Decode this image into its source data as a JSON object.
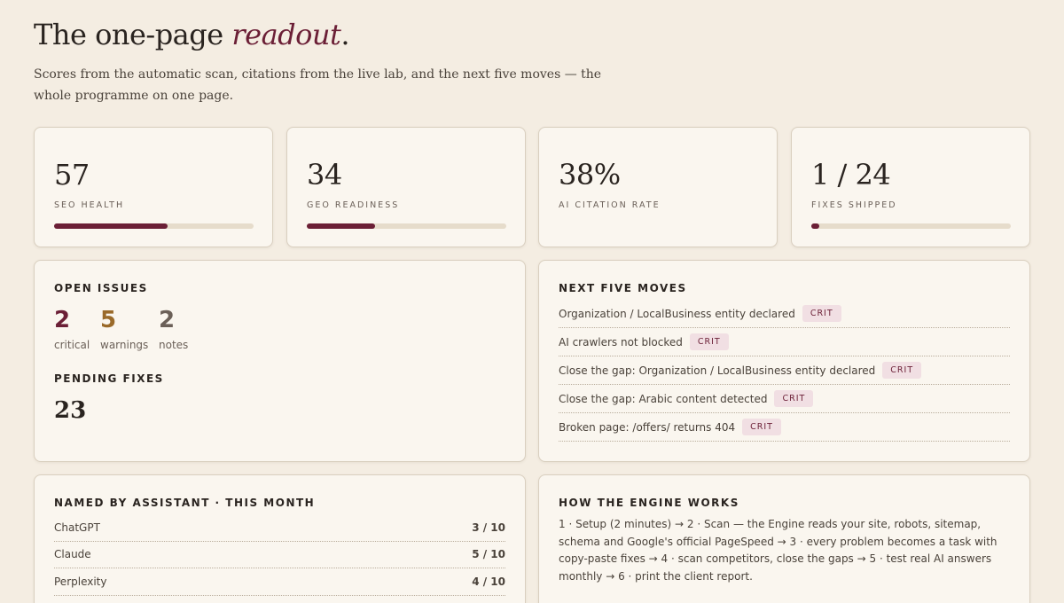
{
  "header": {
    "title_main": "The one-page ",
    "title_accent": "readout",
    "title_end": ".",
    "subtitle": "Scores from the automatic scan, citations from the live lab, and the next five moves — the whole programme on one page."
  },
  "stats": [
    {
      "value": "57",
      "label": "SEO HEALTH",
      "progress": 0.57
    },
    {
      "value": "34",
      "label": "GEO READINESS",
      "progress": 0.34
    },
    {
      "value": "38%",
      "label": "AI CITATION RATE"
    },
    {
      "value": "1 / 24",
      "label": "FIXES SHIPPED",
      "progress": 0.042
    }
  ],
  "issues": {
    "heading": "OPEN ISSUES",
    "groups": [
      {
        "count": "2",
        "label": "critical",
        "color": "#6b1f36"
      },
      {
        "count": "5",
        "label": "warnings",
        "color": "#9a6a2a"
      },
      {
        "count": "2",
        "label": "notes",
        "color": "#6b6058"
      }
    ],
    "pending_heading": "PENDING FIXES",
    "pending_count": "23"
  },
  "moves": {
    "heading": "NEXT FIVE MOVES",
    "items": [
      {
        "text": "Organization / LocalBusiness entity declared",
        "badge": "CRIT"
      },
      {
        "text": "AI crawlers not blocked",
        "badge": "CRIT"
      },
      {
        "text": "Close the gap: Organization / LocalBusiness entity declared",
        "badge": "CRIT"
      },
      {
        "text": "Close the gap: Arabic content detected",
        "badge": "CRIT"
      },
      {
        "text": "Broken page: /offers/ returns 404",
        "badge": "CRIT"
      }
    ]
  },
  "assistants": {
    "heading": "NAMED BY ASSISTANT · THIS MONTH",
    "rows": [
      {
        "name": "ChatGPT",
        "score": "3 / 10"
      },
      {
        "name": "Claude",
        "score": "5 / 10"
      },
      {
        "name": "Perplexity",
        "score": "4 / 10"
      }
    ]
  },
  "engine": {
    "heading": "HOW THE ENGINE WORKS",
    "body": "1 · Setup (2 minutes) → 2 · Scan — the Engine reads your site, robots, sitemap, schema and Google's official PageSpeed → 3 · every problem becomes a task with copy-paste fixes → 4 · scan competitors, close the gaps → 5 · test real AI answers monthly → 6 · print the client report."
  },
  "colors": {
    "accent": "#6b1f36",
    "background": "#f4ede2",
    "card": "#faf6ef",
    "badge_bg": "#f1dfe3",
    "track": "#e6dccb"
  }
}
